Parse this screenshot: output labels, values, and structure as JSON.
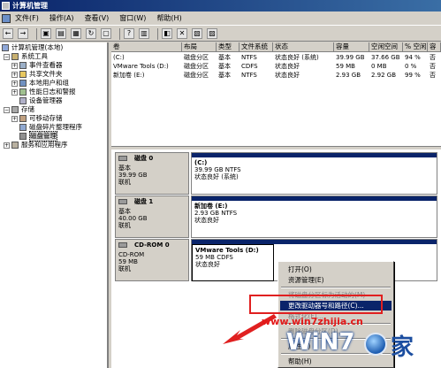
{
  "window": {
    "title": "计算机管理"
  },
  "menubar": {
    "items": [
      "文件(F)",
      "操作(A)",
      "查看(V)",
      "窗口(W)",
      "帮助(H)"
    ]
  },
  "toolbar": {
    "buttons": [
      "back-icon",
      "forward-icon",
      "up-icon",
      "show-tree-icon",
      "properties-icon",
      "refresh-icon",
      "export-icon",
      "help-icon",
      "help2-icon",
      "disk-icon",
      "delete-icon",
      "properties2-icon",
      "help3-icon"
    ]
  },
  "tree": {
    "root": "计算机管理(本地)",
    "system_tools": "系统工具",
    "event_viewer": "事件查看器",
    "shared_folders": "共享文件夹",
    "local_users": "本地用户和组",
    "perf_logs": "性能日志和警报",
    "device_manager": "设备管理器",
    "storage": "存储",
    "removable": "可移动存储",
    "defrag": "磁盘碎片整理程序",
    "disk_mgmt": "磁盘管理",
    "services": "服务和应用程序"
  },
  "volume_list": {
    "headers": [
      "卷",
      "布局",
      "类型",
      "文件系统",
      "状态",
      "容量",
      "空闲空间",
      "% 空闲",
      "容"
    ],
    "rows": [
      [
        "(C:)",
        "磁盘分区",
        "基本",
        "NTFS",
        "状态良好 (系统)",
        "39.99 GB",
        "37.66 GB",
        "94 %",
        "否"
      ],
      [
        "VMware Tools (D:)",
        "磁盘分区",
        "基本",
        "CDFS",
        "状态良好",
        "59 MB",
        "0 MB",
        "0 %",
        "否"
      ],
      [
        "新加卷 (E:)",
        "磁盘分区",
        "基本",
        "NTFS",
        "状态良好",
        "2.93 GB",
        "2.92 GB",
        "99 %",
        "否"
      ]
    ]
  },
  "disks": [
    {
      "name": "磁盘 0",
      "type": "基本",
      "size": "39.99 GB",
      "status": "联机",
      "part_name": "(C:)",
      "part_info": "39.99 GB NTFS",
      "part_status": "状态良好 (系统)"
    },
    {
      "name": "磁盘 1",
      "type": "基本",
      "size": "40.00 GB",
      "status": "联机",
      "part_name": "新加卷 (E:)",
      "part_info": "2.93 GB NTFS",
      "part_status": "状态良好"
    },
    {
      "name": "CD-ROM 0",
      "type": "CD-ROM",
      "size": "59 MB",
      "status": "联机",
      "part_name": "VMware Tools (D:)",
      "part_info": "59 MB CDFS",
      "part_status": "状态良好"
    }
  ],
  "context_menu": {
    "open": "打开(O)",
    "explore": "资源管理(E)",
    "mark_active": "将磁盘分区标为活动的(M)",
    "change_letter": "更改驱动器号和路径(C)...",
    "format": "格式化(F)...",
    "delete": "删除磁盘分区(D)...",
    "properties": "属性(P)",
    "help": "帮助(H)"
  },
  "watermark": {
    "url": "www.win7zhijia.cn",
    "logo": "WiN7",
    "orb_char": "之",
    "jia": "家",
    "sub": "Win7之家"
  },
  "colors": {
    "titlebar": "#0a246a",
    "highlight": "#0a246a",
    "redbox": "#e02020"
  }
}
